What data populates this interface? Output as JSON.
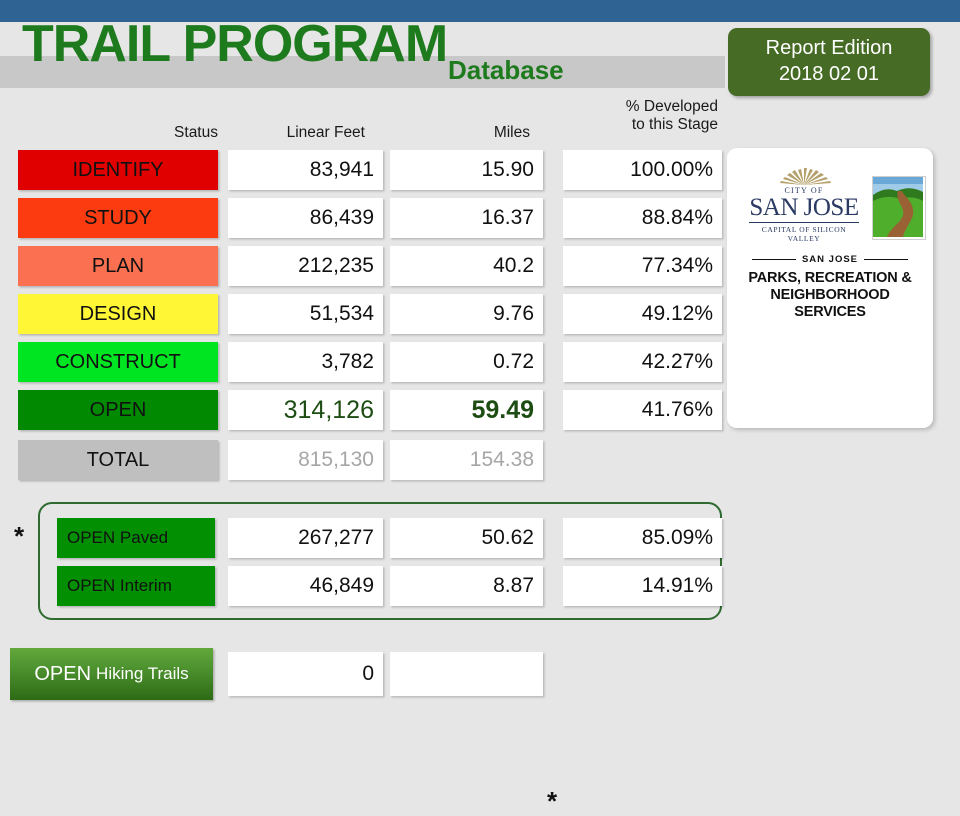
{
  "header": {
    "title_main": "TRAIL PROGRAM",
    "title_sub": "Database",
    "report_label": "Report Edition",
    "report_date": "2018 02 01",
    "accent_green": "#1d7a1d",
    "topbar_color": "#2f6394",
    "report_box_color": "#456b24"
  },
  "table": {
    "columns": {
      "status": "Status",
      "linear_feet": "Linear Feet",
      "miles": "Miles",
      "percent_line1": "% Developed",
      "percent_line2": "to this Stage"
    },
    "rows": [
      {
        "status": "IDENTIFY",
        "linear_feet": "83,941",
        "miles": "15.90",
        "percent": "100.00%",
        "color": "#e00000"
      },
      {
        "status": "STUDY",
        "linear_feet": "86,439",
        "miles": "16.37",
        "percent": "88.84%",
        "color": "#fc3c10"
      },
      {
        "status": "PLAN",
        "linear_feet": "212,235",
        "miles": "40.2",
        "percent": "77.34%",
        "color": "#fa7050"
      },
      {
        "status": "DESIGN",
        "linear_feet": "51,534",
        "miles": "9.76",
        "percent": "49.12%",
        "color": "#fff735"
      },
      {
        "status": "CONSTRUCT",
        "linear_feet": "3,782",
        "miles": "0.72",
        "percent": "42.27%",
        "color": "#00e522"
      },
      {
        "status": "OPEN",
        "linear_feet": "314,126",
        "miles": "59.49",
        "percent": "41.76%",
        "color": "#018a01"
      },
      {
        "status": "TOTAL",
        "linear_feet": "815,130",
        "miles": "154.38",
        "percent": "",
        "color": "#bfbfbf"
      }
    ]
  },
  "footnote_marker": "*",
  "subgroup": {
    "rows": [
      {
        "label": "OPEN Paved",
        "linear_feet": "267,277",
        "miles": "50.62",
        "percent": "85.09%"
      },
      {
        "label": "OPEN Interim",
        "linear_feet": "46,849",
        "miles": "8.87",
        "percent": "14.91%"
      }
    ],
    "border_color": "#2f6b2f",
    "box_color": "#028f02"
  },
  "hiking": {
    "label_bold": "OPEN",
    "label_rest": "Hiking Trails",
    "linear_feet": "0",
    "miles": ""
  },
  "logo": {
    "city_of": "CITY OF",
    "city_name": "SAN JOSE",
    "city_tagline": "CAPITAL OF SILICON VALLEY",
    "dept_top": "SAN JOSE",
    "dept_line1": "PARKS, RECREATION &",
    "dept_line2": "NEIGHBORHOOD SERVICES"
  },
  "chart_data": {
    "type": "table",
    "title": "TRAIL PROGRAM Database",
    "columns": [
      "Status",
      "Linear Feet",
      "Miles",
      "% Developed to this Stage"
    ],
    "categories": [
      "IDENTIFY",
      "STUDY",
      "PLAN",
      "DESIGN",
      "CONSTRUCT",
      "OPEN",
      "TOTAL",
      "OPEN Paved",
      "OPEN Interim",
      "OPEN Hiking Trails"
    ],
    "series": [
      {
        "name": "Linear Feet",
        "values": [
          83941,
          86439,
          212235,
          51534,
          3782,
          314126,
          815130,
          267277,
          46849,
          0
        ]
      },
      {
        "name": "Miles",
        "values": [
          15.9,
          16.37,
          40.2,
          9.76,
          0.72,
          59.49,
          154.38,
          50.62,
          8.87,
          null
        ]
      },
      {
        "name": "% Developed to this Stage",
        "values": [
          100.0,
          88.84,
          77.34,
          49.12,
          42.27,
          41.76,
          null,
          85.09,
          14.91,
          null
        ]
      }
    ]
  }
}
